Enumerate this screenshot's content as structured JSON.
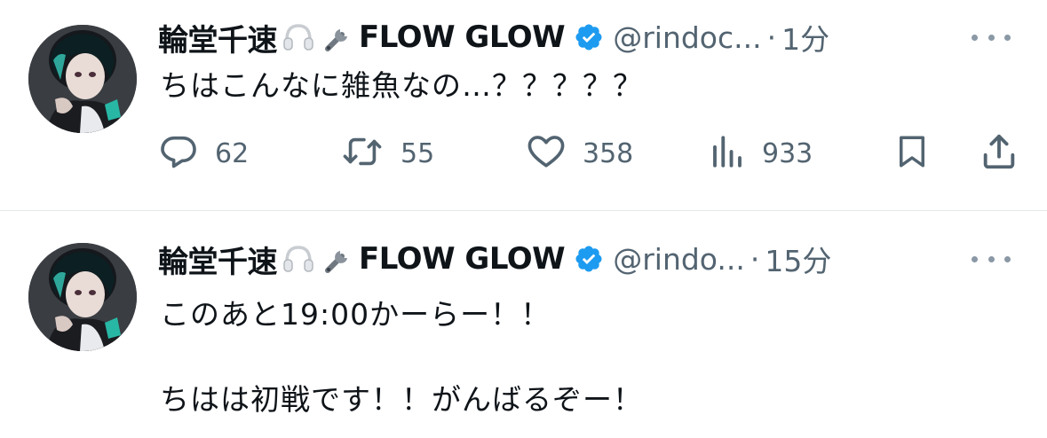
{
  "tweets": [
    {
      "display_name": "輪堂千速",
      "name_tail": "FLOW GLOW",
      "name_emojis": [
        "headphones-emoji",
        "wrench-emoji"
      ],
      "handle": "@rindoc...",
      "separator": "·",
      "time": "1分",
      "text": "ちはこんなに雑魚なの…？？？？？",
      "actions": {
        "replies": "62",
        "retweets": "55",
        "likes": "358",
        "views": "933"
      }
    },
    {
      "display_name": "輪堂千速",
      "name_tail": "FLOW GLOW",
      "name_emojis": [
        "headphones-emoji",
        "wrench-emoji"
      ],
      "handle": "@rindo...",
      "separator": "·",
      "time": "15分",
      "text": "このあと19:00かーらー！！\n\nちはは初戦です！！がんばるぞー！"
    }
  ],
  "icons": [
    "reply-icon",
    "retweet-icon",
    "like-icon",
    "views-icon",
    "bookmark-icon",
    "share-icon",
    "more-icon",
    "verified-icon"
  ],
  "colors": {
    "text": "#0f1419",
    "secondary": "#536471",
    "verified": "#1d9bf0",
    "divider": "#e6e9eb"
  }
}
